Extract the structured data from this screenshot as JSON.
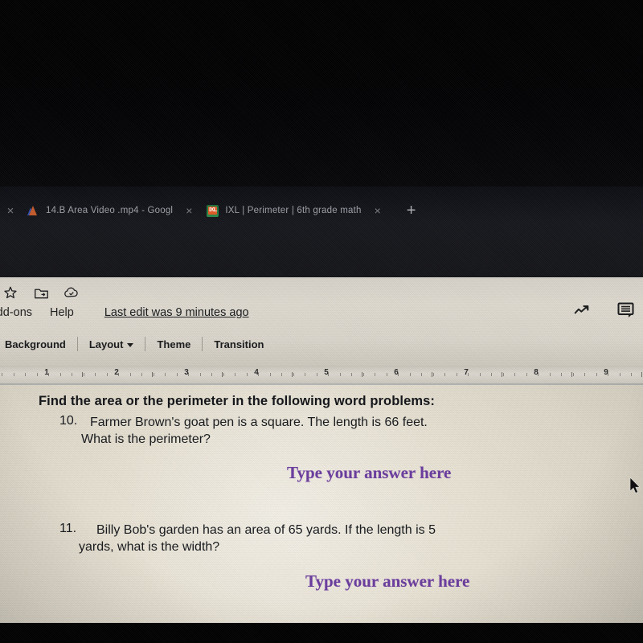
{
  "browser": {
    "leftmost_close_icon": "×",
    "new_tab_label": "+",
    "tabs": [
      {
        "title": "14.B Area Video .mp4 - Googl",
        "favicon": "drive-video-icon",
        "close_label": "×"
      },
      {
        "title": "IXL | Perimeter | 6th grade math",
        "favicon": "ixl-icon",
        "close_label": "×"
      }
    ]
  },
  "app": {
    "quick_icons": [
      {
        "name": "star-icon",
        "label": "Star"
      },
      {
        "name": "move-to-folder-icon",
        "label": "Move to folder"
      },
      {
        "name": "drive-sync-icon",
        "label": "Saved to Drive"
      }
    ],
    "menu_items": [
      {
        "label": "Add-ons"
      },
      {
        "label": "Help"
      }
    ],
    "last_edit": "Last edit was 9 minutes ago",
    "right_icons": [
      {
        "name": "explore-trending-icon",
        "label": "Explore"
      },
      {
        "name": "comment-icon",
        "label": "Comments"
      }
    ],
    "toolbar": [
      {
        "label": "Background",
        "has_caret": false
      },
      {
        "label": "Layout",
        "has_caret": true
      },
      {
        "label": "Theme",
        "has_caret": false
      },
      {
        "label": "Transition",
        "has_caret": false
      }
    ],
    "ruler": {
      "numbers": [
        "1",
        "2",
        "3",
        "4",
        "5",
        "6",
        "7",
        "8",
        "9"
      ]
    }
  },
  "slide": {
    "heading": "Find the area or the perimeter in the following word problems:",
    "questions": [
      {
        "number": "10.",
        "line1": "Farmer Brown's goat pen is a square. The length is 66 feet.",
        "line2": "What is the perimeter?",
        "answer_placeholder": "Type your answer here"
      },
      {
        "number": "11.",
        "line1": "Billy Bob's garden has an area of 65 yards. If the length is 5",
        "line2": "yards, what is the width?",
        "answer_placeholder": "Type your answer here"
      }
    ],
    "colors": {
      "answer_purple": "#6a3b9e",
      "text_dark": "#14171b",
      "slide_background": "#e9e3d5"
    }
  },
  "cursor": {
    "name": "mouse-pointer"
  }
}
